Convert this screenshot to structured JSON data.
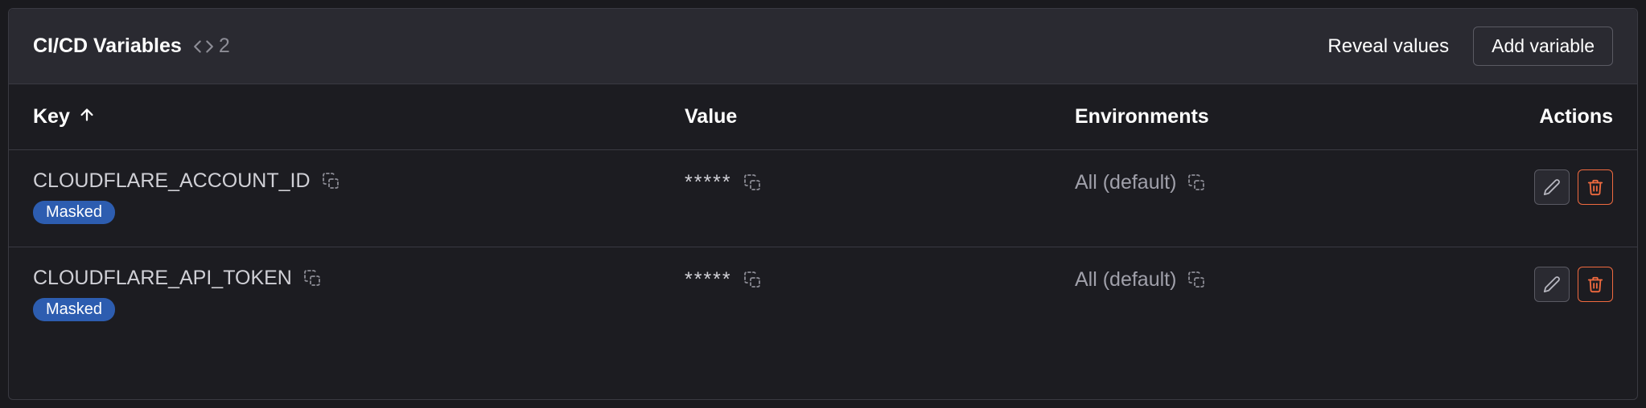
{
  "header": {
    "title": "CI/CD Variables",
    "count": "2",
    "reveal_label": "Reveal values",
    "add_label": "Add variable"
  },
  "columns": {
    "key": "Key",
    "value": "Value",
    "env": "Environments",
    "actions": "Actions"
  },
  "badge_masked": "Masked",
  "rows": [
    {
      "key": "CLOUDFLARE_ACCOUNT_ID",
      "value": "*****",
      "env": "All (default)",
      "masked": true
    },
    {
      "key": "CLOUDFLARE_API_TOKEN",
      "value": "*****",
      "env": "All (default)",
      "masked": true
    }
  ]
}
